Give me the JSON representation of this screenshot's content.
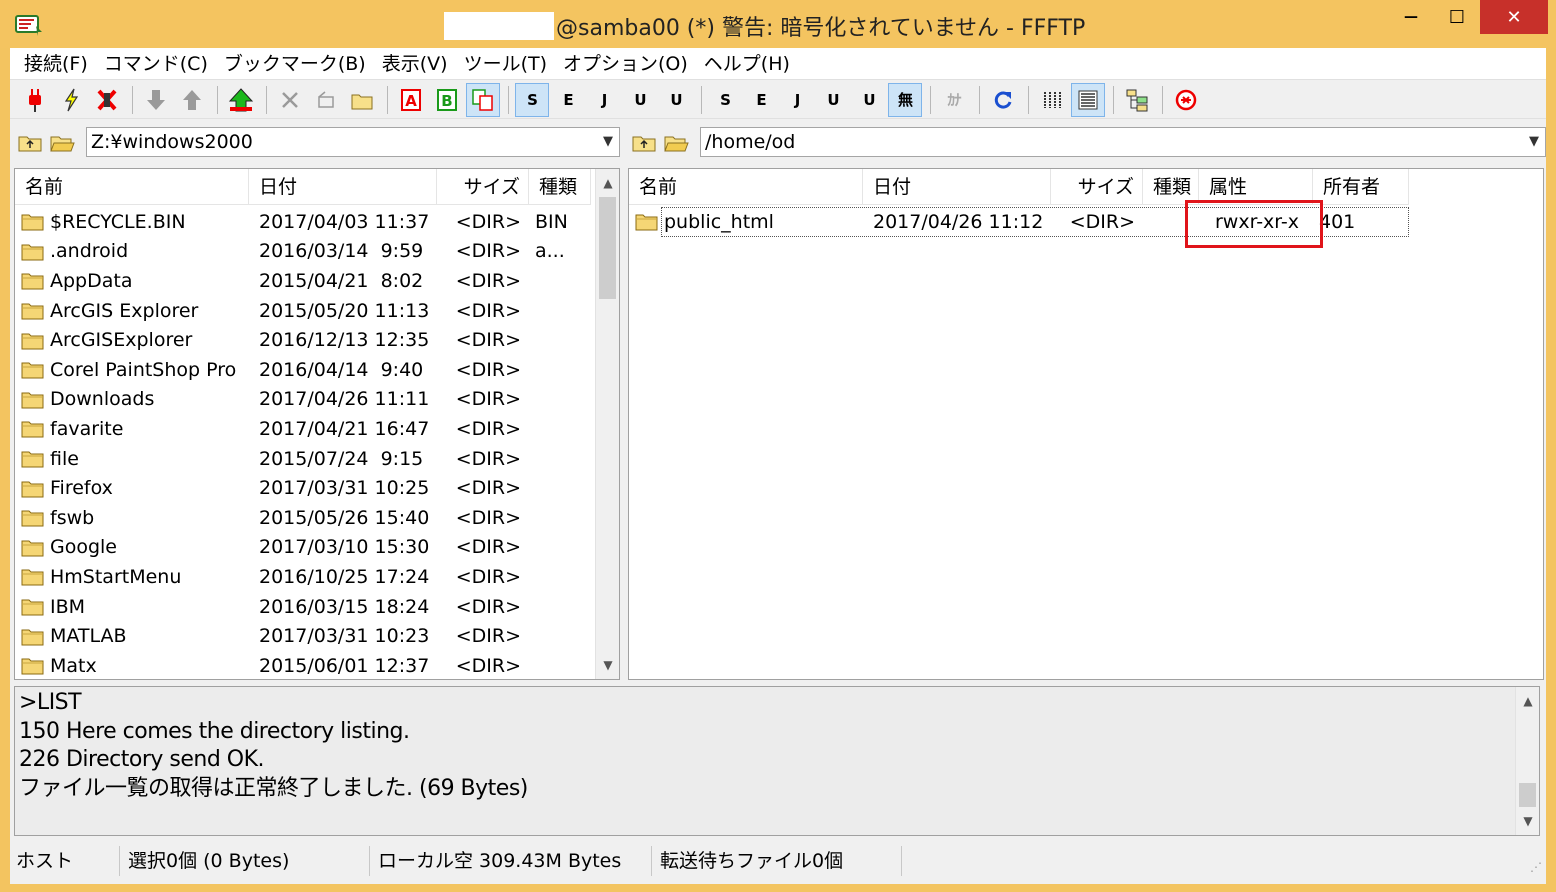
{
  "window": {
    "title": "@samba00 (*) 警告: 暗号化されていません - FFFTP",
    "min_glyph": "—",
    "max_glyph": "☐",
    "close_glyph": "✕"
  },
  "menu": [
    "接続(F)",
    "コマンド(C)",
    "ブックマーク(B)",
    "表示(V)",
    "ツール(T)",
    "オプション(O)",
    "ヘルプ(H)"
  ],
  "toolbar": {
    "sjis": "S",
    "euc": "E",
    "jis": "J",
    "utf8n": "U",
    "utf8b": "U",
    "sjis2": "S",
    "euc2": "E",
    "jis2": "J",
    "utf8n2": "U",
    "utf8b2": "U",
    "no_convert": "無",
    "kana": "ｶﾅ"
  },
  "local": {
    "path": "Z:¥windows2000",
    "columns": [
      "名前",
      "日付",
      "サイズ",
      "種類"
    ],
    "rows": [
      {
        "name": "$RECYCLE.BIN",
        "date": "2017/04/03 11:37",
        "size": "<DIR>",
        "type": "BIN"
      },
      {
        "name": ".android",
        "date": "2016/03/14  9:59",
        "size": "<DIR>",
        "type": "a..."
      },
      {
        "name": "AppData",
        "date": "2015/04/21  8:02",
        "size": "<DIR>",
        "type": ""
      },
      {
        "name": "ArcGIS Explorer",
        "date": "2015/05/20 11:13",
        "size": "<DIR>",
        "type": ""
      },
      {
        "name": "ArcGISExplorer",
        "date": "2016/12/13 12:35",
        "size": "<DIR>",
        "type": ""
      },
      {
        "name": "Corel PaintShop Pro",
        "date": "2016/04/14  9:40",
        "size": "<DIR>",
        "type": ""
      },
      {
        "name": "Downloads",
        "date": "2017/04/26 11:11",
        "size": "<DIR>",
        "type": ""
      },
      {
        "name": "favarite",
        "date": "2017/04/21 16:47",
        "size": "<DIR>",
        "type": ""
      },
      {
        "name": "file",
        "date": "2015/07/24  9:15",
        "size": "<DIR>",
        "type": ""
      },
      {
        "name": "Firefox",
        "date": "2017/03/31 10:25",
        "size": "<DIR>",
        "type": ""
      },
      {
        "name": "fswb",
        "date": "2015/05/26 15:40",
        "size": "<DIR>",
        "type": ""
      },
      {
        "name": "Google",
        "date": "2017/03/10 15:30",
        "size": "<DIR>",
        "type": ""
      },
      {
        "name": "HmStartMenu",
        "date": "2016/10/25 17:24",
        "size": "<DIR>",
        "type": ""
      },
      {
        "name": "IBM",
        "date": "2016/03/15 18:24",
        "size": "<DIR>",
        "type": ""
      },
      {
        "name": "MATLAB",
        "date": "2017/03/31 10:23",
        "size": "<DIR>",
        "type": ""
      },
      {
        "name": "Matx",
        "date": "2015/06/01 12:37",
        "size": "<DIR>",
        "type": ""
      }
    ]
  },
  "remote": {
    "path": "/home/od",
    "columns": [
      "名前",
      "日付",
      "サイズ",
      "種類",
      "属性",
      "所有者"
    ],
    "rows": [
      {
        "name": "public_html",
        "date": "2017/04/26 11:12",
        "size": "<DIR>",
        "type": "",
        "attr": "rwxr-xr-x",
        "owner": "401"
      }
    ]
  },
  "log": [
    ">LIST",
    "150 Here comes the directory listing.",
    "226 Directory send OK.",
    "ファイル一覧の取得は正常終了しました. (69 Bytes)"
  ],
  "status": {
    "host": "ホスト",
    "selected": "選択0個 (0 Bytes)",
    "local_free": "ローカル空 309.43M Bytes",
    "queue": "転送待ちファイル0個"
  },
  "colors": {
    "titlebar": "#f4c460",
    "close_button": "#c7302a",
    "highlight": "#e0141a",
    "pressed_button": "#cde4f7"
  }
}
